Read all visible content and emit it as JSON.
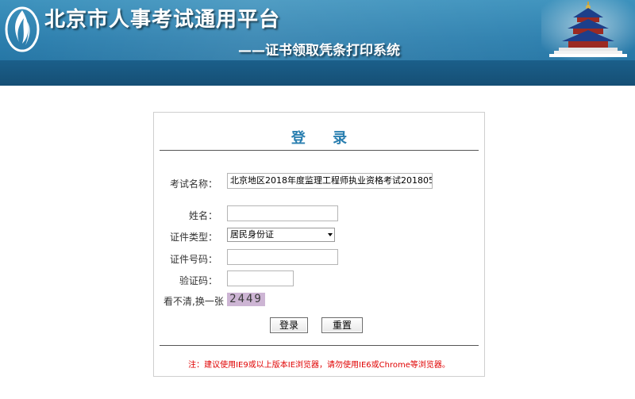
{
  "header": {
    "title": "北京市人事考试通用平台",
    "subtitle": "——证书领取凭条打印系统"
  },
  "login": {
    "title": "登 录",
    "fields": {
      "exam_name": {
        "label": "考试名称：",
        "value": "北京地区2018年度监理工程师执业资格考试201805"
      },
      "name": {
        "label": "姓名：",
        "value": ""
      },
      "id_type": {
        "label": "证件类型：",
        "selected": "居民身份证"
      },
      "id_number": {
        "label": "证件号码：",
        "value": ""
      },
      "captcha": {
        "label": "验证码：",
        "value": ""
      }
    },
    "captcha_refresh": "看不清,换一张",
    "captcha_code": "2449",
    "buttons": {
      "login": "登录",
      "reset": "重置"
    },
    "note": "注：建议使用IE9或以上版本IE浏览器，请勿使用IE6或Chrome等浏览器。"
  },
  "colors": {
    "header_blue": "#2c7fae",
    "header_band": "#1b5f8a",
    "title_blue": "#2a7fb0",
    "note_red": "#e00000",
    "captcha_bg": "#cdb5d4"
  },
  "icons": {
    "logo": "flame-logo-icon",
    "temple": "temple-of-heaven-icon",
    "dropdown": "chevron-down-icon"
  }
}
